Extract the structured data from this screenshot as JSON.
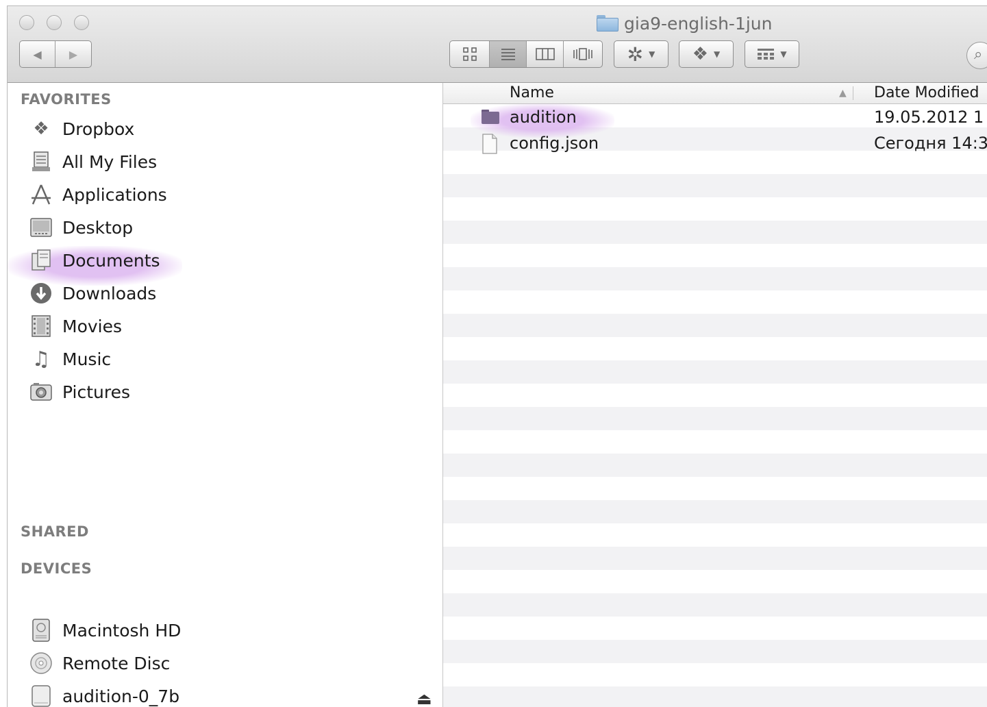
{
  "window": {
    "title": "gia9-english-1jun"
  },
  "toolbar": {
    "back_icon": "back-arrow-icon",
    "forward_icon": "forward-arrow-icon",
    "view_modes": [
      "icon-view",
      "list-view",
      "column-view",
      "coverflow-view"
    ],
    "active_view": "list-view"
  },
  "sidebar": {
    "favorites_label": "FAVORITES",
    "favorites": [
      {
        "label": "Dropbox",
        "icon": "dropbox-icon"
      },
      {
        "label": "All My Files",
        "icon": "all-files-icon"
      },
      {
        "label": "Applications",
        "icon": "applications-icon"
      },
      {
        "label": "Desktop",
        "icon": "desktop-icon"
      },
      {
        "label": "Documents",
        "icon": "documents-icon"
      },
      {
        "label": "Downloads",
        "icon": "downloads-icon"
      },
      {
        "label": "Movies",
        "icon": "movies-icon"
      },
      {
        "label": "Music",
        "icon": "music-icon"
      },
      {
        "label": "Pictures",
        "icon": "pictures-icon"
      }
    ],
    "shared_label": "SHARED",
    "devices_label": "DEVICES",
    "devices": [
      {
        "label": "Macintosh HD",
        "icon": "hard-disk-icon"
      },
      {
        "label": "Remote Disc",
        "icon": "disc-icon"
      },
      {
        "label": "audition-0_7b",
        "icon": "volume-icon"
      }
    ]
  },
  "list": {
    "columns": {
      "name": "Name",
      "date": "Date Modified"
    },
    "rows": [
      {
        "name": "audition",
        "date": "19.05.2012 1",
        "type": "folder"
      },
      {
        "name": "config.json",
        "date": "Сегодня 14:3",
        "type": "file"
      }
    ]
  },
  "colors": {
    "highlight": "#dcb8f0",
    "sidebar_section": "#7d7d7d"
  }
}
